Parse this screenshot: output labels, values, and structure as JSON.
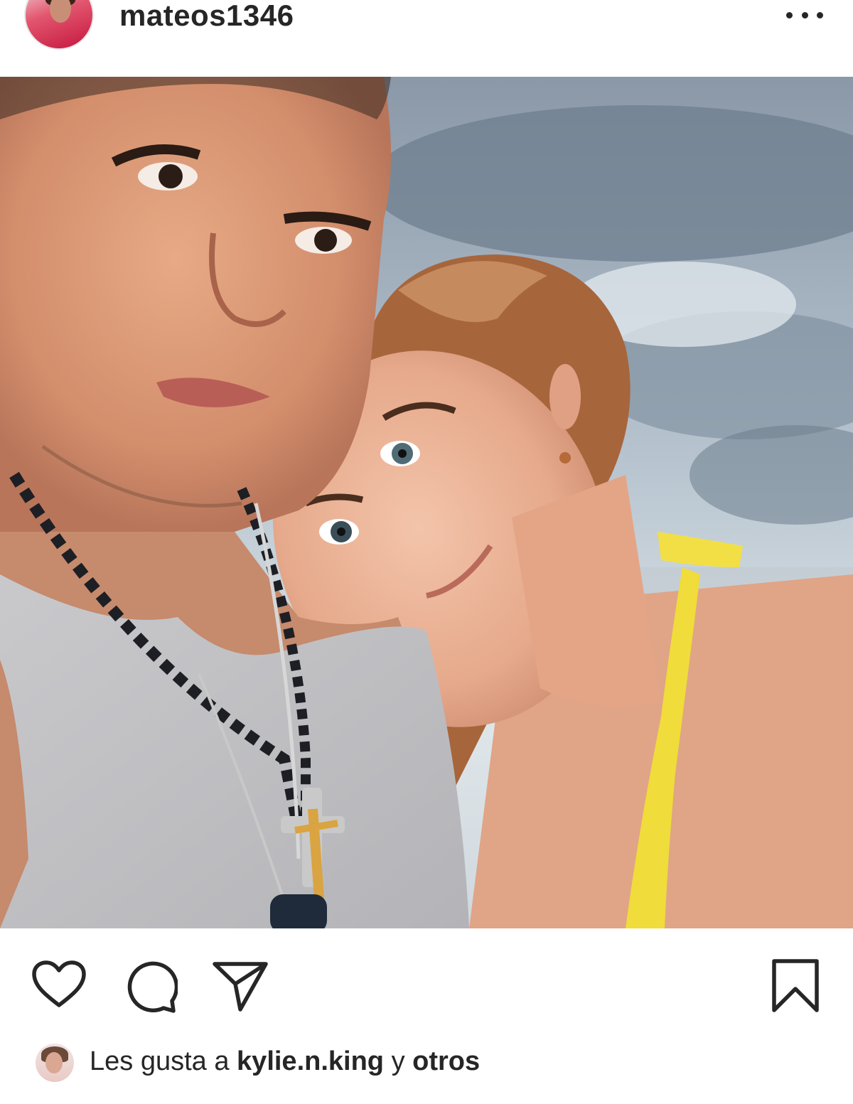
{
  "post": {
    "username": "mateos1346",
    "more_icon": "more-horizontal-icon"
  },
  "actions": {
    "like_icon": "heart-icon",
    "comment_icon": "comment-bubble-icon",
    "share_icon": "paper-plane-icon",
    "save_icon": "bookmark-icon"
  },
  "likes": {
    "prefix": "Les gusta a ",
    "user": "kylie.n.king",
    "connector": " y ",
    "others": "otros"
  }
}
